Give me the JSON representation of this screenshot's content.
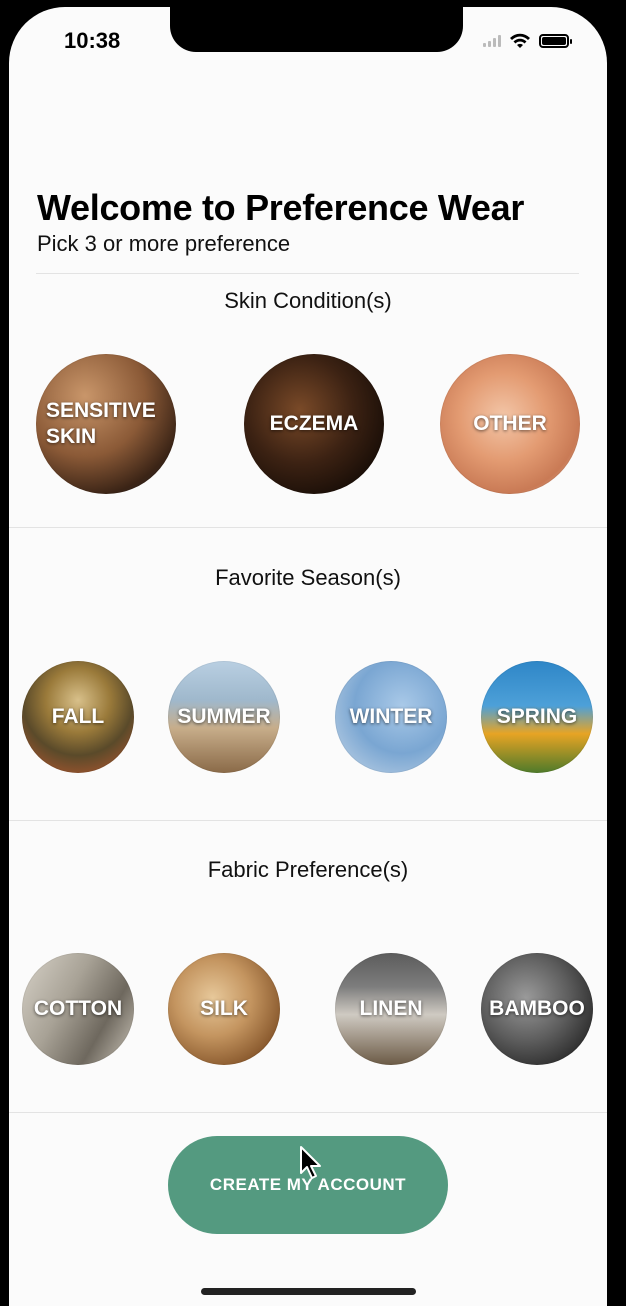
{
  "status_bar": {
    "time": "10:38"
  },
  "header": {
    "title": "Welcome to Preference Wear",
    "subtitle": "Pick 3 or more preference"
  },
  "sections": {
    "skin": {
      "title": "Skin Condition(s)",
      "items": [
        {
          "label": "SENSITIVE SKIN"
        },
        {
          "label": "ECZEMA"
        },
        {
          "label": "OTHER"
        }
      ]
    },
    "season": {
      "title": "Favorite Season(s)",
      "items": [
        {
          "label": "FALL"
        },
        {
          "label": "SUMMER"
        },
        {
          "label": "WINTER"
        },
        {
          "label": "SPRING"
        }
      ]
    },
    "fabric": {
      "title": "Fabric Preference(s)",
      "items": [
        {
          "label": "COTTON"
        },
        {
          "label": "SILK"
        },
        {
          "label": "LINEN"
        },
        {
          "label": "BAMBOO"
        }
      ]
    }
  },
  "cta": {
    "label": "CREATE MY ACCOUNT"
  },
  "colors": {
    "accent": "#549a80"
  }
}
